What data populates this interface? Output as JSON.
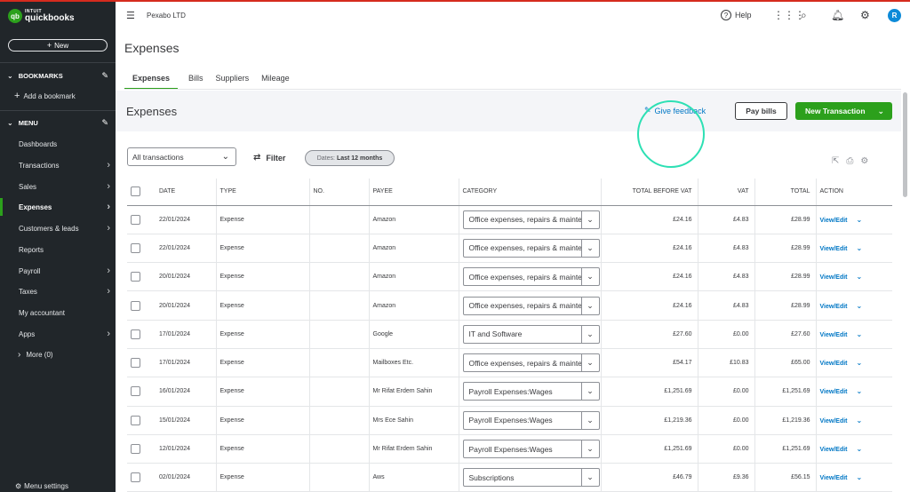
{
  "brand": {
    "top": "INTUIT",
    "bottom": "quickbooks",
    "badge": "qb"
  },
  "sidebar": {
    "new_label": "New",
    "bookmarks_label": "BOOKMARKS",
    "add_bookmark": "Add a bookmark",
    "menu_label": "MENU",
    "items": [
      {
        "label": "Dashboards",
        "arrow": false
      },
      {
        "label": "Transactions",
        "arrow": true
      },
      {
        "label": "Sales",
        "arrow": true
      },
      {
        "label": "Expenses",
        "arrow": true,
        "active": true
      },
      {
        "label": "Customers & leads",
        "arrow": true
      },
      {
        "label": "Reports",
        "arrow": false
      },
      {
        "label": "Payroll",
        "arrow": true
      },
      {
        "label": "Taxes",
        "arrow": true
      },
      {
        "label": "My accountant",
        "arrow": false
      },
      {
        "label": "Apps",
        "arrow": true
      }
    ],
    "more_label": "More (0)",
    "menu_settings": "Menu settings"
  },
  "topbar": {
    "company": "Pexabo LTD",
    "help": "Help",
    "avatar_initial": "R"
  },
  "page": {
    "title": "Expenses",
    "tabs": [
      "Expenses",
      "Bills",
      "Suppliers",
      "Mileage"
    ],
    "section_title": "Expenses",
    "give_feedback": "Give feedback",
    "pay_bills": "Pay bills",
    "new_transaction": "New Transaction"
  },
  "filters": {
    "transactions_select": "All transactions",
    "filter_label": "Filter",
    "dates_prefix": "Dates:",
    "dates_value": "Last 12 months"
  },
  "table": {
    "headers": {
      "date": "DATE",
      "type": "TYPE",
      "no": "NO.",
      "payee": "PAYEE",
      "category": "CATEGORY",
      "total_before_vat": "TOTAL BEFORE VAT",
      "vat": "VAT",
      "total": "TOTAL",
      "action": "ACTION"
    },
    "rows": [
      {
        "date": "22/01/2024",
        "type": "Expense",
        "no": "",
        "payee": "Amazon",
        "category": "Office expenses, repairs & maintenance",
        "before_vat": "£24.16",
        "vat": "£4.83",
        "total": "£28.99",
        "action": "View/Edit"
      },
      {
        "date": "22/01/2024",
        "type": "Expense",
        "no": "",
        "payee": "Amazon",
        "category": "Office expenses, repairs & maintenance",
        "before_vat": "£24.16",
        "vat": "£4.83",
        "total": "£28.99",
        "action": "View/Edit"
      },
      {
        "date": "20/01/2024",
        "type": "Expense",
        "no": "",
        "payee": "Amazon",
        "category": "Office expenses, repairs & maintenance",
        "before_vat": "£24.16",
        "vat": "£4.83",
        "total": "£28.99",
        "action": "View/Edit"
      },
      {
        "date": "20/01/2024",
        "type": "Expense",
        "no": "",
        "payee": "Amazon",
        "category": "Office expenses, repairs & maintenance",
        "before_vat": "£24.16",
        "vat": "£4.83",
        "total": "£28.99",
        "action": "View/Edit"
      },
      {
        "date": "17/01/2024",
        "type": "Expense",
        "no": "",
        "payee": "Google",
        "category": "IT and Software",
        "before_vat": "£27.60",
        "vat": "£0.00",
        "total": "£27.60",
        "action": "View/Edit"
      },
      {
        "date": "17/01/2024",
        "type": "Expense",
        "no": "",
        "payee": "Mailboxes Etc.",
        "category": "Office expenses, repairs & maintenance",
        "before_vat": "£54.17",
        "vat": "£10.83",
        "total": "£65.00",
        "action": "View/Edit"
      },
      {
        "date": "16/01/2024",
        "type": "Expense",
        "no": "",
        "payee": "Mr Rifat Erdem Sahin",
        "category": "Payroll Expenses:Wages",
        "before_vat": "£1,251.69",
        "vat": "£0.00",
        "total": "£1,251.69",
        "action": "View/Edit"
      },
      {
        "date": "15/01/2024",
        "type": "Expense",
        "no": "",
        "payee": "Mrs Ece Sahin",
        "category": "Payroll Expenses:Wages",
        "before_vat": "£1,219.36",
        "vat": "£0.00",
        "total": "£1,219.36",
        "action": "View/Edit"
      },
      {
        "date": "12/01/2024",
        "type": "Expense",
        "no": "",
        "payee": "Mr Rifat Erdem Sahin",
        "category": "Payroll Expenses:Wages",
        "before_vat": "£1,251.69",
        "vat": "£0.00",
        "total": "£1,251.69",
        "action": "View/Edit"
      },
      {
        "date": "02/01/2024",
        "type": "Expense",
        "no": "",
        "payee": "Aws",
        "category": "Subscriptions",
        "before_vat": "£46.79",
        "vat": "£9.36",
        "total": "£56.15",
        "action": "View/Edit"
      }
    ]
  },
  "colors": {
    "sidebar_bg": "#21262a",
    "accent_green": "#2ca01c",
    "link_blue": "#0077c5",
    "cursor_highlight": "#2de0b4"
  }
}
